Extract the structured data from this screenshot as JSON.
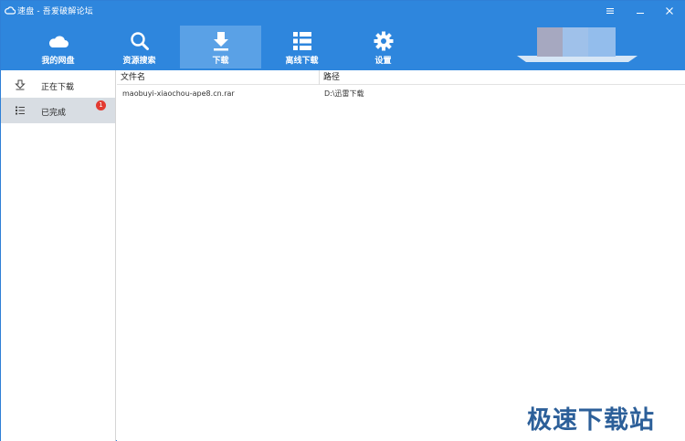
{
  "window": {
    "title": "速盘 - 吾爱破解论坛"
  },
  "toolbar": {
    "items": [
      {
        "label": "我的网盘",
        "icon": "cloud-icon"
      },
      {
        "label": "资源搜索",
        "icon": "search-icon"
      },
      {
        "label": "下载",
        "icon": "download-icon",
        "active": true
      },
      {
        "label": "离线下载",
        "icon": "grid-list-icon"
      },
      {
        "label": "设置",
        "icon": "gear-icon"
      }
    ]
  },
  "sidebar": {
    "items": [
      {
        "label": "正在下载",
        "icon": "download-arrow-outline-icon"
      },
      {
        "label": "已完成",
        "icon": "list-icon",
        "badge": "1",
        "selected": true
      }
    ]
  },
  "table": {
    "columns": [
      "文件名",
      "路径"
    ],
    "rows": [
      {
        "filename": "maobuyi-xiaochou-ape8.cn.rar",
        "path": "D:\\迅雷下载"
      }
    ]
  },
  "watermark": "极速下载站",
  "colors": {
    "titlebar_blue": "#2e86dd",
    "active_tab": "#5aa1e6",
    "badge_red": "#e33b32",
    "watermark_blue": "#2c5f99"
  }
}
